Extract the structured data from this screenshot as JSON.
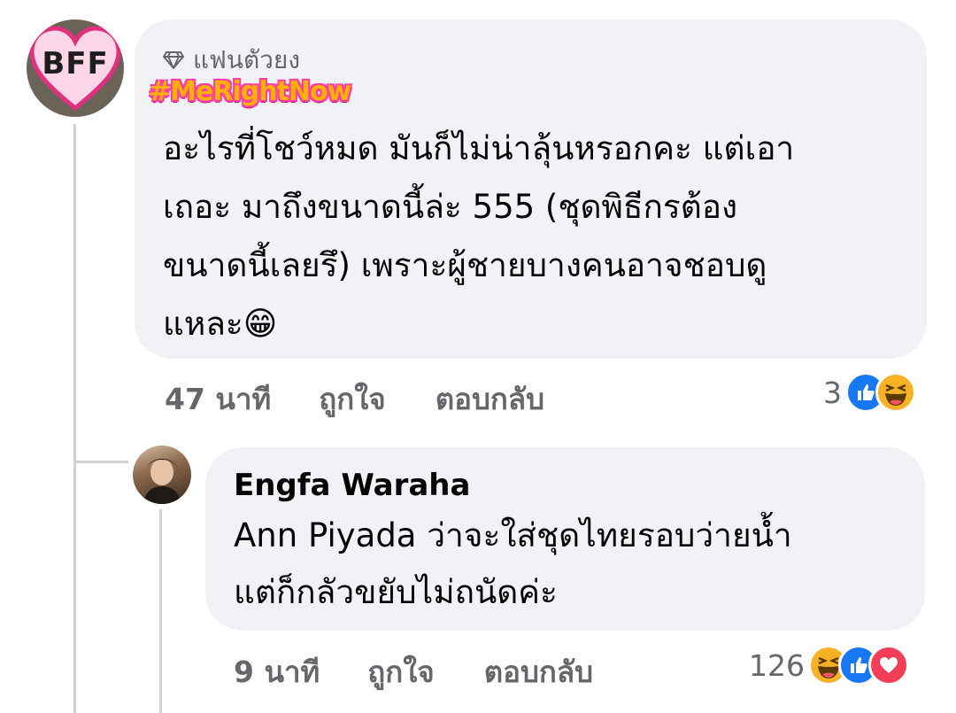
{
  "comment1": {
    "avatar_badge": "BFF",
    "badge_label": "แฟนตัวยง",
    "hashtag": "#MeRightNow",
    "lines": [
      "อะไรที่โชว์หมด มันก็ไม่น่าลุ้นหรอกคะ แต่เอา",
      "เถอะ  มาถึงขนาดนี้ล่ะ 555 (ชุดพิธีกรต้อง",
      "ขนาดนี้เลยรึ) เพราะผู้ชายบางคนอาจชอบดู",
      "แหละ😁"
    ],
    "time": "47 นาที",
    "like_label": "ถูกใจ",
    "reply_label": "ตอบกลับ",
    "reaction_count": "3",
    "reaction_icons": [
      "like-icon",
      "haha-icon"
    ]
  },
  "reply1": {
    "author": "Engfa Waraha",
    "lines": [
      "Ann Piyada  ว่าจะใส่ชุดไทยรอบว่ายน้ำ",
      "แต่ก็กลัวขยับไม่ถนัดค่ะ"
    ],
    "time": "9 นาที",
    "like_label": "ถูกใจ",
    "reply_label": "ตอบกลับ",
    "reaction_count": "126",
    "reaction_icons": [
      "haha-icon",
      "like-icon",
      "love-icon"
    ]
  },
  "colors": {
    "bubble": "#f0f2f5",
    "like": "#1877f2",
    "love": "#f33e58",
    "secondary_text": "#65676b"
  }
}
